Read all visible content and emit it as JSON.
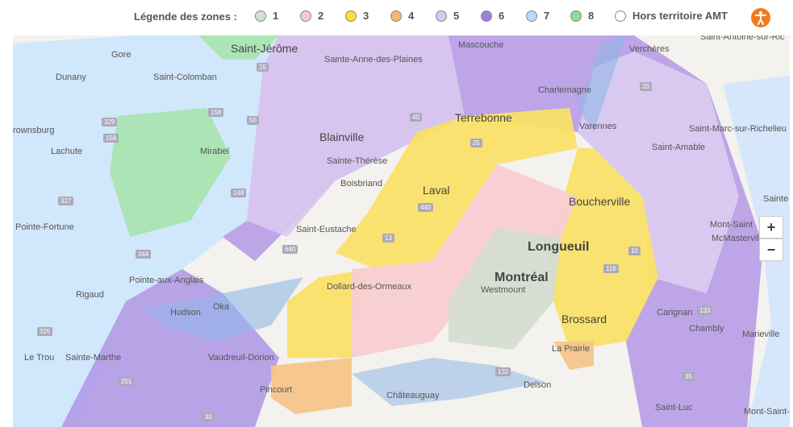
{
  "legend": {
    "title": "Légende des zones :",
    "items": [
      {
        "label": "1",
        "color": "#cfe3cf"
      },
      {
        "label": "2",
        "color": "#f8c7cc"
      },
      {
        "label": "3",
        "color": "#f9de3c"
      },
      {
        "label": "4",
        "color": "#f5b86a"
      },
      {
        "label": "5",
        "color": "#d9c6ee"
      },
      {
        "label": "6",
        "color": "#9e7ee0"
      },
      {
        "label": "7",
        "color": "#b6dafb"
      },
      {
        "label": "8",
        "color": "#8fdb9a"
      },
      {
        "label": "Hors territoire AMT",
        "color": "#ffffff"
      }
    ],
    "accessibility_icon": "accessibility-icon"
  },
  "map": {
    "places": [
      {
        "name": "Saint-Jérôme"
      },
      {
        "name": "Mascouche"
      },
      {
        "name": "Saint-Antoine-sur-Ric"
      },
      {
        "name": "Verchères"
      },
      {
        "name": "Gore"
      },
      {
        "name": "Sainte-Anne-des-Plaines"
      },
      {
        "name": "Dunany"
      },
      {
        "name": "Saint-Colomban"
      },
      {
        "name": "Charlemagne"
      },
      {
        "name": "Terrebonne"
      },
      {
        "name": "Varennes"
      },
      {
        "name": "rownsburg"
      },
      {
        "name": "Lachute"
      },
      {
        "name": "Mirabel"
      },
      {
        "name": "Blainville"
      },
      {
        "name": "Saint-Marc-sur-Richelieu"
      },
      {
        "name": "Saint-Amable"
      },
      {
        "name": "Sainte-Thérèse"
      },
      {
        "name": "Boisbriand"
      },
      {
        "name": "Laval"
      },
      {
        "name": "Boucherville"
      },
      {
        "name": "Sainte"
      },
      {
        "name": "Pointe-Fortune"
      },
      {
        "name": "Saint-Eustache"
      },
      {
        "name": "Mont-Saint"
      },
      {
        "name": "Longueuil"
      },
      {
        "name": "McMasterville"
      },
      {
        "name": "Pointe-aux-Anglais"
      },
      {
        "name": "Montréal"
      },
      {
        "name": "Dollard-des-Ormeaux"
      },
      {
        "name": "Westmount"
      },
      {
        "name": "Rigaud"
      },
      {
        "name": "Hudson"
      },
      {
        "name": "Oka"
      },
      {
        "name": "Carignan"
      },
      {
        "name": "Brossard"
      },
      {
        "name": "Chambly"
      },
      {
        "name": "Marieville"
      },
      {
        "name": "Le Trou"
      },
      {
        "name": "Sainte-Marthe"
      },
      {
        "name": "Vaudreuil-Dorion"
      },
      {
        "name": "La Prairie"
      },
      {
        "name": "Pincourt"
      },
      {
        "name": "Châteauguay"
      },
      {
        "name": "Delson"
      },
      {
        "name": "Saint-Luc"
      },
      {
        "name": "Mont-Saint-Grégoir"
      }
    ],
    "routes": [
      "158",
      "50",
      "329",
      "158",
      "148",
      "327",
      "640",
      "15",
      "25",
      "40",
      "344",
      "20",
      "116",
      "133",
      "35",
      "201",
      "132",
      "30",
      "325",
      "13",
      "440",
      "10"
    ],
    "zoom_in_label": "+",
    "zoom_out_label": "−"
  }
}
